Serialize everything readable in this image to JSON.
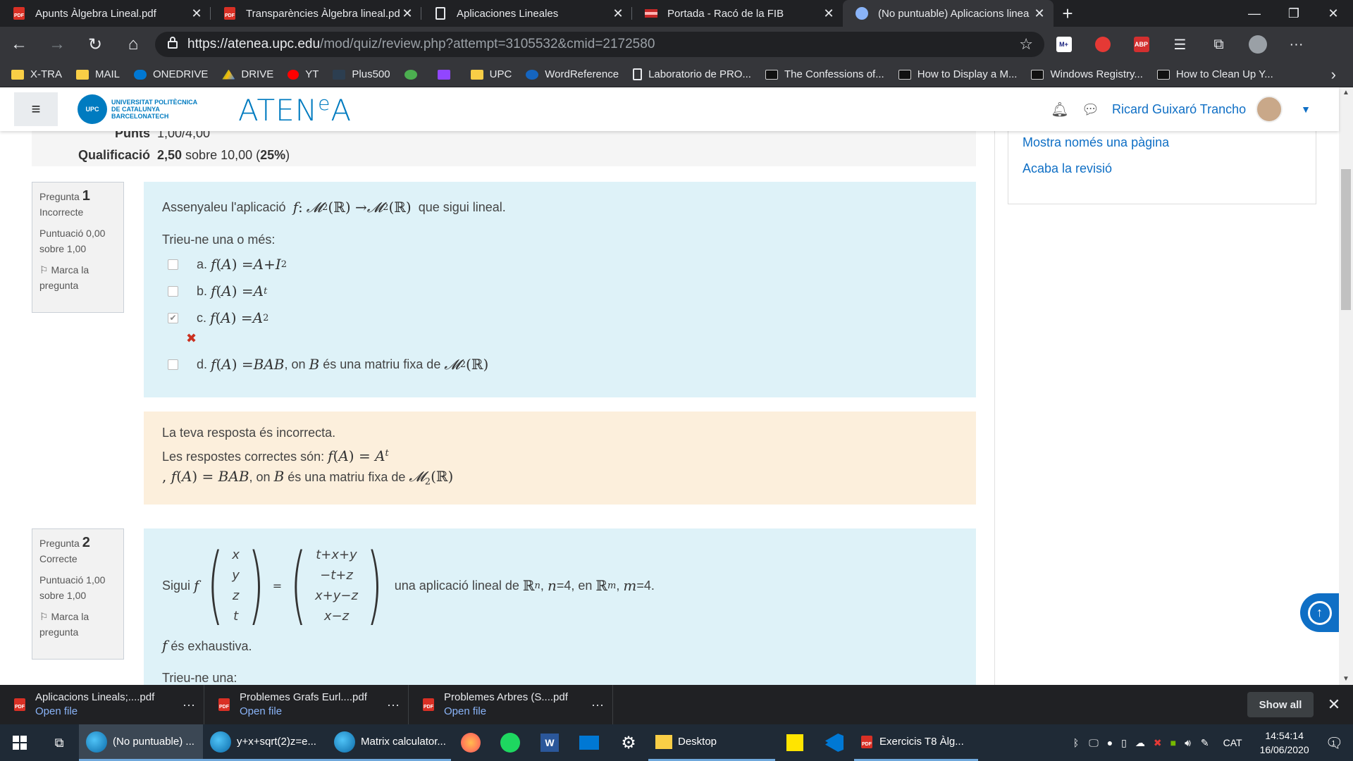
{
  "browser": {
    "tabs": [
      {
        "label": "Apunts Àlgebra Lineal.pdf",
        "icon": "pdf-icon"
      },
      {
        "label": "Transparències Àlgebra lineal.pdf",
        "icon": "pdf-icon"
      },
      {
        "label": "Aplicaciones Lineales",
        "icon": "document-icon"
      },
      {
        "label": "Portada - Racó de la FIB",
        "icon": "flag-icon"
      },
      {
        "label": "(No puntuable) Aplicacions linea",
        "icon": "globe-icon",
        "active": true
      }
    ],
    "new_tab": "+",
    "window_controls": {
      "minimize": "—",
      "maximize": "❐",
      "close": "✕"
    },
    "url_host": "https://atenea.upc.edu",
    "url_path": "/mod/quiz/review.php?attempt=3105532&cmid=2172580",
    "extensions": [
      "M+",
      "ABP"
    ],
    "bookmarks": [
      "X-TRA",
      "MAIL",
      "ONEDRIVE",
      "DRIVE",
      "YT",
      "Plus500",
      "",
      "",
      "UPC",
      "WordReference",
      "Laboratorio de PRO...",
      "The Confessions of...",
      "How to Display a M...",
      "Windows Registry...",
      "How to Clean Up Y..."
    ]
  },
  "site": {
    "university_lines": [
      "UNIVERSITAT POLITÈCNICA",
      "DE CATALUNYA",
      "BARCELONATECH"
    ],
    "upc_badge": "UPC",
    "brand": "ATENEA",
    "brand_sup": "e",
    "user_name": "Ricard Guixaró Trancho"
  },
  "summary": {
    "rows": [
      {
        "label": "Punts",
        "value": "1,00/4,00"
      },
      {
        "label": "Qualificació",
        "value_bold": "2,50",
        "value_rest": " sobre 10,00 (",
        "value_pct": "25%",
        "value_end": ")"
      }
    ]
  },
  "sidebar": {
    "links": [
      "Mostra només una pàgina",
      "Acaba la revisió"
    ]
  },
  "question1": {
    "prefix": "Pregunta",
    "number": "1",
    "state": "Incorrecte",
    "score": "Puntuació 0,00 sobre 1,00",
    "flag": "Marca la pregunta",
    "text_before": "Assenyaleu l'aplicació",
    "text_after": "que sigui lineal.",
    "prompt": "Trieu-ne una o més:",
    "options": [
      {
        "letter": "a.",
        "checked": false
      },
      {
        "letter": "b.",
        "checked": false
      },
      {
        "letter": "c.",
        "checked": true
      },
      {
        "letter": "d.",
        "checked": false,
        "text_mid": ", on",
        "text_after": "és una matriu fixa de"
      }
    ],
    "feedback_wrong": "La teva resposta és incorrecta.",
    "feedback_correct_prefix": "Les respostes correctes són:",
    "feedback_second_mid": ", on",
    "feedback_second_after": "és una matriu fixa de"
  },
  "question2": {
    "prefix": "Pregunta",
    "number": "2",
    "state": "Correcte",
    "score": "Puntuació 1,00 sobre 1,00",
    "flag": "Marca la pregunta",
    "text_before": "Sigui",
    "vector_in": [
      "x",
      "y",
      "z",
      "t"
    ],
    "vector_out": [
      "t+x+y",
      "−t+z",
      "x+y−z",
      "x−z"
    ],
    "text_after": "una aplicació lineal de",
    "n_value": "4",
    "m_value": "4",
    "statement": "és exhaustiva.",
    "prompt": "Trieu-ne una:"
  },
  "downloads": {
    "items": [
      {
        "name": "Aplicacions Lineals;....pdf",
        "action": "Open file"
      },
      {
        "name": "Problemes Grafs Eurl....pdf",
        "action": "Open file"
      },
      {
        "name": "Problemes Arbres (S....pdf",
        "action": "Open file"
      }
    ],
    "show_all": "Show all"
  },
  "taskbar": {
    "apps": [
      "(No puntuable) ...",
      "y+x+sqrt(2)z=e...",
      "Matrix calculator..."
    ],
    "desktop": "Desktop",
    "exercise": "Exercicis T8 Àlg...",
    "language": "CAT",
    "time": "14:54:14",
    "date": "16/06/2020",
    "notif_count": "1"
  },
  "colors": {
    "link": "#0f6fc5",
    "question_bg": "#def2f8",
    "feedback_bg": "#fcefdc",
    "brand": "#007bc0"
  }
}
